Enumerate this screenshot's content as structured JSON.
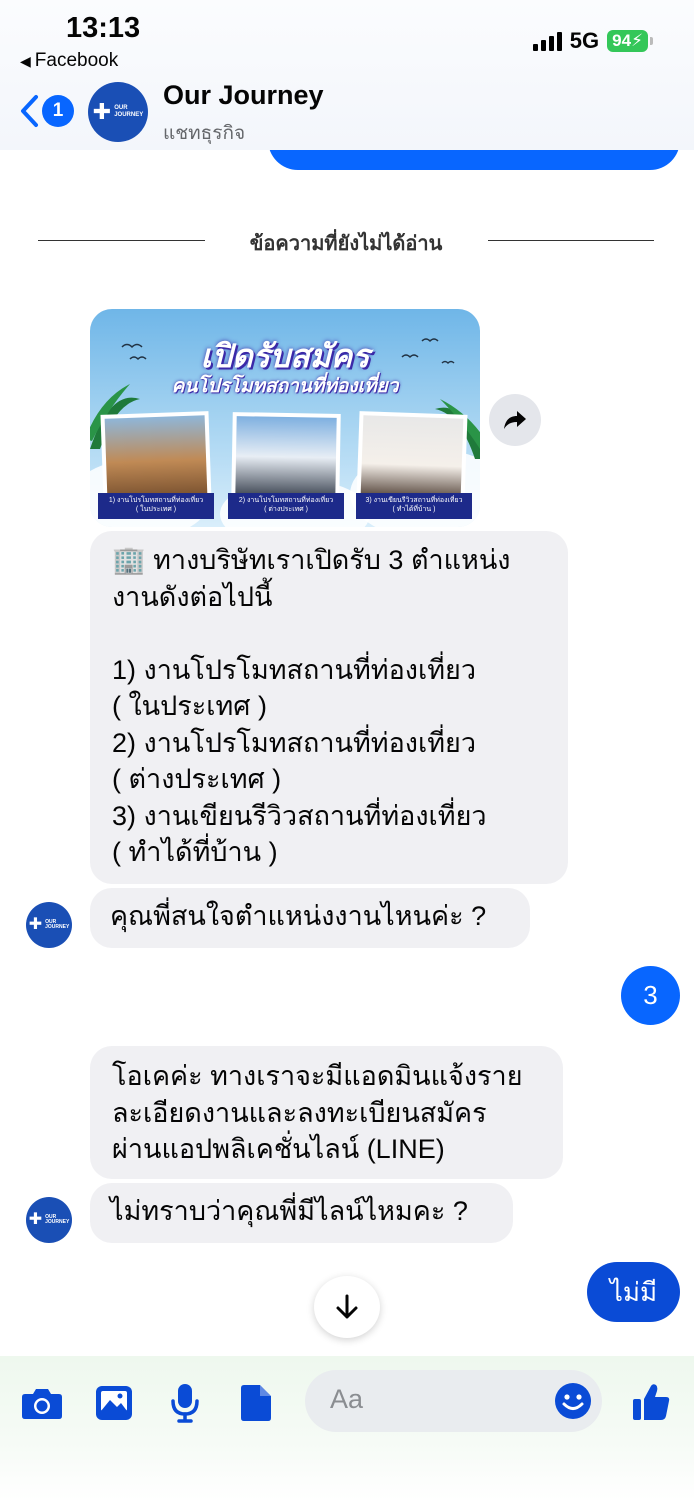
{
  "status_bar": {
    "time": "13:13",
    "back_app": "Facebook",
    "network": "5G",
    "battery": "94"
  },
  "header": {
    "unread_count": "1",
    "chat_name": "Our Journey",
    "chat_subtitle": "แชทธุรกิจ",
    "avatar_wordmark_top": "OUR",
    "avatar_wordmark_bottom": "JOURNEY"
  },
  "divider": {
    "label": "ข้อความที่ยังไม่ได้อ่าน"
  },
  "promo_card": {
    "title_line1": "เปิดรับสมัคร",
    "title_line2": "คนโปรโมทสถานที่ท่องเที่ยว",
    "captions": [
      {
        "line1": "1) งานโปรโมทสถานที่ท่องเที่ยว",
        "line2": "( ในประเทศ )"
      },
      {
        "line1": "2) งานโปรโมทสถานที่ท่องเที่ยว",
        "line2": "( ต่างประเทศ )"
      },
      {
        "line1": "3) งานเขียนรีวิวสถานที่ท่องเที่ยว",
        "line2": "( ทำได้ที่บ้าน )"
      }
    ]
  },
  "messages": {
    "positions_intro": [
      "🏢 ทางบริษัทเราเปิดรับ 3 ตำแหน่ง",
      "งานดังต่อไปนี้",
      "",
      "1) งานโปรโมทสถานที่ท่องเที่ยว",
      "( ในประเทศ )",
      "2) งานโปรโมทสถานที่ท่องเที่ยว",
      "( ต่างประเทศ )",
      "3) งานเขียนรีวิวสถานที่ท่องเที่ยว",
      "( ทำได้ที่บ้าน )"
    ],
    "question_position": "คุณพี่สนใจตำแหน่งงานไหนค่ะ ?",
    "reply_choice": "3",
    "line_info": [
      "โอเคค่ะ ทางเราจะมีแอดมินแจ้งราย",
      "ละเอียดงานและลงทะเบียนสมัคร",
      "ผ่านแอปพลิเคชั่นไลน์  (LINE)"
    ],
    "question_line": "ไม่ทราบว่าคุณพี่มีไลน์ไหมคะ ?",
    "reply_no": "ไม่มี"
  },
  "composer": {
    "placeholder": "Aa"
  },
  "icons": [
    "camera-icon",
    "image-icon",
    "microphone-icon",
    "file-icon",
    "emoji-icon",
    "thumbs-up-icon",
    "share-icon",
    "arrow-down-icon",
    "back-chevron-icon"
  ],
  "colors": {
    "brand_blue": "#0866ff",
    "incoming_bubble": "#f0f0f3",
    "avatar_blue": "#1a4fb5",
    "battery_green": "#34c759"
  }
}
